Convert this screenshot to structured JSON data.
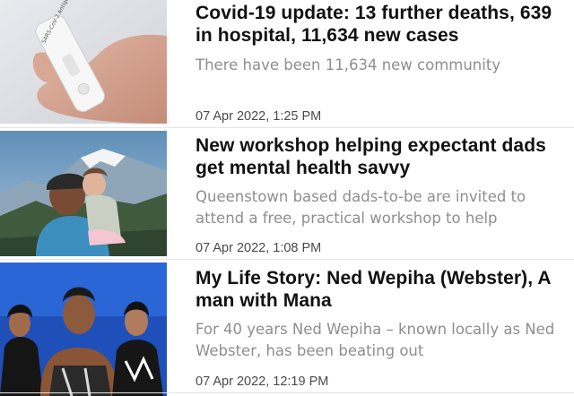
{
  "articles": [
    {
      "headline": "Covid-19 update: 13 further deaths, 639 in hospital, 11,634 new cases",
      "summary": "There have been 11,634 new community",
      "timestamp": "07 Apr 2022, 1:25 PM",
      "image_label": "SARS-CoV-2 Antigen"
    },
    {
      "headline": "New workshop helping expectant dads get mental health savvy",
      "summary": "Queenstown based dads-to-be are invited to attend a free, practical workshop to help",
      "timestamp": "07 Apr 2022, 1:08 PM"
    },
    {
      "headline": "My Life Story: Ned Wepiha (Webster), A man with Mana",
      "summary": "For 40 years Ned Wepiha – known locally as Ned Webster, has been beating out",
      "timestamp": "07 Apr 2022, 12:19 PM"
    }
  ]
}
